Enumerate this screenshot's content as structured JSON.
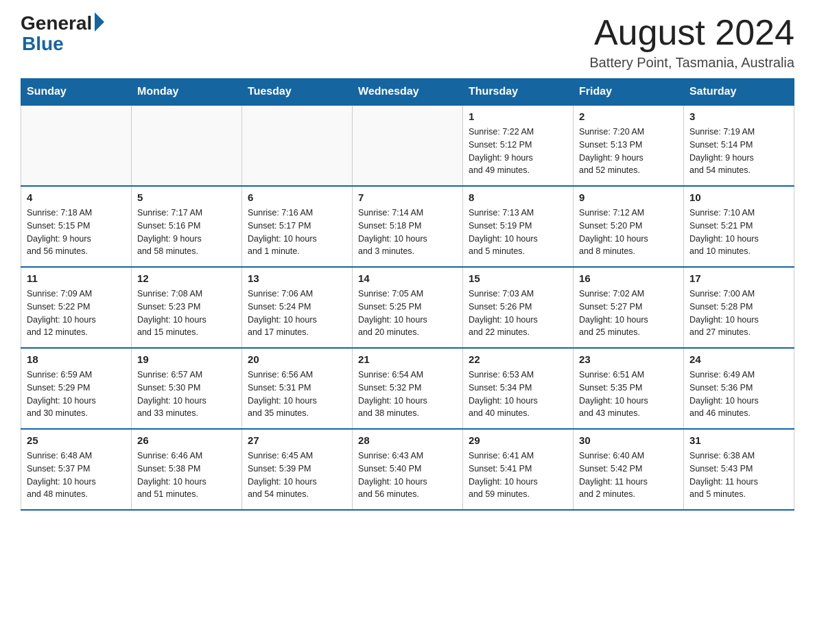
{
  "header": {
    "logo_general": "General",
    "logo_blue": "Blue",
    "month_title": "August 2024",
    "location": "Battery Point, Tasmania, Australia"
  },
  "days_of_week": [
    "Sunday",
    "Monday",
    "Tuesday",
    "Wednesday",
    "Thursday",
    "Friday",
    "Saturday"
  ],
  "weeks": [
    [
      {
        "day": "",
        "info": ""
      },
      {
        "day": "",
        "info": ""
      },
      {
        "day": "",
        "info": ""
      },
      {
        "day": "",
        "info": ""
      },
      {
        "day": "1",
        "info": "Sunrise: 7:22 AM\nSunset: 5:12 PM\nDaylight: 9 hours\nand 49 minutes."
      },
      {
        "day": "2",
        "info": "Sunrise: 7:20 AM\nSunset: 5:13 PM\nDaylight: 9 hours\nand 52 minutes."
      },
      {
        "day": "3",
        "info": "Sunrise: 7:19 AM\nSunset: 5:14 PM\nDaylight: 9 hours\nand 54 minutes."
      }
    ],
    [
      {
        "day": "4",
        "info": "Sunrise: 7:18 AM\nSunset: 5:15 PM\nDaylight: 9 hours\nand 56 minutes."
      },
      {
        "day": "5",
        "info": "Sunrise: 7:17 AM\nSunset: 5:16 PM\nDaylight: 9 hours\nand 58 minutes."
      },
      {
        "day": "6",
        "info": "Sunrise: 7:16 AM\nSunset: 5:17 PM\nDaylight: 10 hours\nand 1 minute."
      },
      {
        "day": "7",
        "info": "Sunrise: 7:14 AM\nSunset: 5:18 PM\nDaylight: 10 hours\nand 3 minutes."
      },
      {
        "day": "8",
        "info": "Sunrise: 7:13 AM\nSunset: 5:19 PM\nDaylight: 10 hours\nand 5 minutes."
      },
      {
        "day": "9",
        "info": "Sunrise: 7:12 AM\nSunset: 5:20 PM\nDaylight: 10 hours\nand 8 minutes."
      },
      {
        "day": "10",
        "info": "Sunrise: 7:10 AM\nSunset: 5:21 PM\nDaylight: 10 hours\nand 10 minutes."
      }
    ],
    [
      {
        "day": "11",
        "info": "Sunrise: 7:09 AM\nSunset: 5:22 PM\nDaylight: 10 hours\nand 12 minutes."
      },
      {
        "day": "12",
        "info": "Sunrise: 7:08 AM\nSunset: 5:23 PM\nDaylight: 10 hours\nand 15 minutes."
      },
      {
        "day": "13",
        "info": "Sunrise: 7:06 AM\nSunset: 5:24 PM\nDaylight: 10 hours\nand 17 minutes."
      },
      {
        "day": "14",
        "info": "Sunrise: 7:05 AM\nSunset: 5:25 PM\nDaylight: 10 hours\nand 20 minutes."
      },
      {
        "day": "15",
        "info": "Sunrise: 7:03 AM\nSunset: 5:26 PM\nDaylight: 10 hours\nand 22 minutes."
      },
      {
        "day": "16",
        "info": "Sunrise: 7:02 AM\nSunset: 5:27 PM\nDaylight: 10 hours\nand 25 minutes."
      },
      {
        "day": "17",
        "info": "Sunrise: 7:00 AM\nSunset: 5:28 PM\nDaylight: 10 hours\nand 27 minutes."
      }
    ],
    [
      {
        "day": "18",
        "info": "Sunrise: 6:59 AM\nSunset: 5:29 PM\nDaylight: 10 hours\nand 30 minutes."
      },
      {
        "day": "19",
        "info": "Sunrise: 6:57 AM\nSunset: 5:30 PM\nDaylight: 10 hours\nand 33 minutes."
      },
      {
        "day": "20",
        "info": "Sunrise: 6:56 AM\nSunset: 5:31 PM\nDaylight: 10 hours\nand 35 minutes."
      },
      {
        "day": "21",
        "info": "Sunrise: 6:54 AM\nSunset: 5:32 PM\nDaylight: 10 hours\nand 38 minutes."
      },
      {
        "day": "22",
        "info": "Sunrise: 6:53 AM\nSunset: 5:34 PM\nDaylight: 10 hours\nand 40 minutes."
      },
      {
        "day": "23",
        "info": "Sunrise: 6:51 AM\nSunset: 5:35 PM\nDaylight: 10 hours\nand 43 minutes."
      },
      {
        "day": "24",
        "info": "Sunrise: 6:49 AM\nSunset: 5:36 PM\nDaylight: 10 hours\nand 46 minutes."
      }
    ],
    [
      {
        "day": "25",
        "info": "Sunrise: 6:48 AM\nSunset: 5:37 PM\nDaylight: 10 hours\nand 48 minutes."
      },
      {
        "day": "26",
        "info": "Sunrise: 6:46 AM\nSunset: 5:38 PM\nDaylight: 10 hours\nand 51 minutes."
      },
      {
        "day": "27",
        "info": "Sunrise: 6:45 AM\nSunset: 5:39 PM\nDaylight: 10 hours\nand 54 minutes."
      },
      {
        "day": "28",
        "info": "Sunrise: 6:43 AM\nSunset: 5:40 PM\nDaylight: 10 hours\nand 56 minutes."
      },
      {
        "day": "29",
        "info": "Sunrise: 6:41 AM\nSunset: 5:41 PM\nDaylight: 10 hours\nand 59 minutes."
      },
      {
        "day": "30",
        "info": "Sunrise: 6:40 AM\nSunset: 5:42 PM\nDaylight: 11 hours\nand 2 minutes."
      },
      {
        "day": "31",
        "info": "Sunrise: 6:38 AM\nSunset: 5:43 PM\nDaylight: 11 hours\nand 5 minutes."
      }
    ]
  ]
}
